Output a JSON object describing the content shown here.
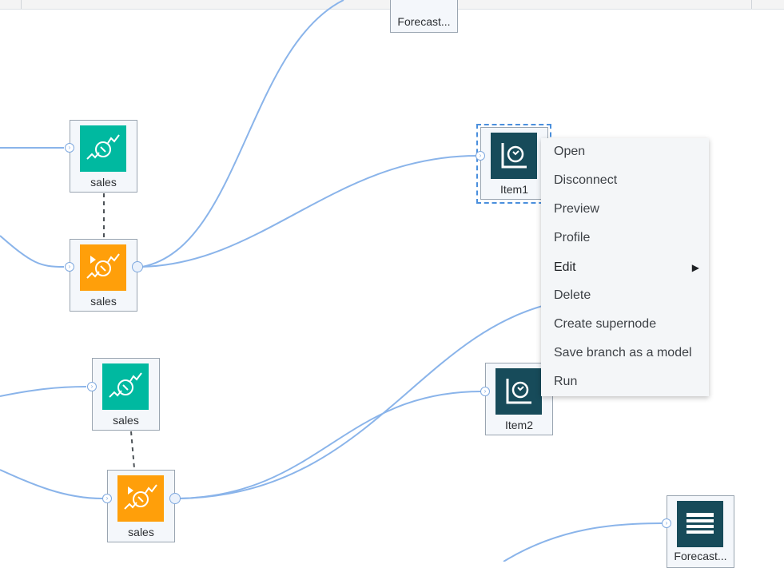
{
  "canvas": {
    "link_color": "#8ab4ea",
    "nodes": [
      {
        "id": "forecast-top",
        "label": "Forecast..."
      },
      {
        "id": "sales-1",
        "label": "sales"
      },
      {
        "id": "sales-2",
        "label": "sales"
      },
      {
        "id": "item1",
        "label": "Item1"
      },
      {
        "id": "sales-3",
        "label": "sales"
      },
      {
        "id": "item2",
        "label": "Item2"
      },
      {
        "id": "sales-4",
        "label": "sales"
      },
      {
        "id": "forecast-bottom",
        "label": "Forecast..."
      }
    ],
    "icons": {
      "teal": "time-series-icon",
      "orange": "time-series-run-icon",
      "dark": "analysis-chart-icon",
      "table": "table-icon"
    },
    "colors": {
      "teal": "#00b9a0",
      "orange": "#ff9f0a",
      "dark": "#174b5a"
    }
  },
  "context_menu": {
    "items": [
      {
        "label": "Open"
      },
      {
        "label": "Disconnect"
      },
      {
        "label": "Preview"
      },
      {
        "label": "Profile"
      },
      {
        "label": "Edit",
        "submenu": true
      },
      {
        "label": "Delete"
      },
      {
        "label": "Create supernode"
      },
      {
        "label": "Save branch as a model"
      },
      {
        "label": "Run"
      }
    ]
  }
}
